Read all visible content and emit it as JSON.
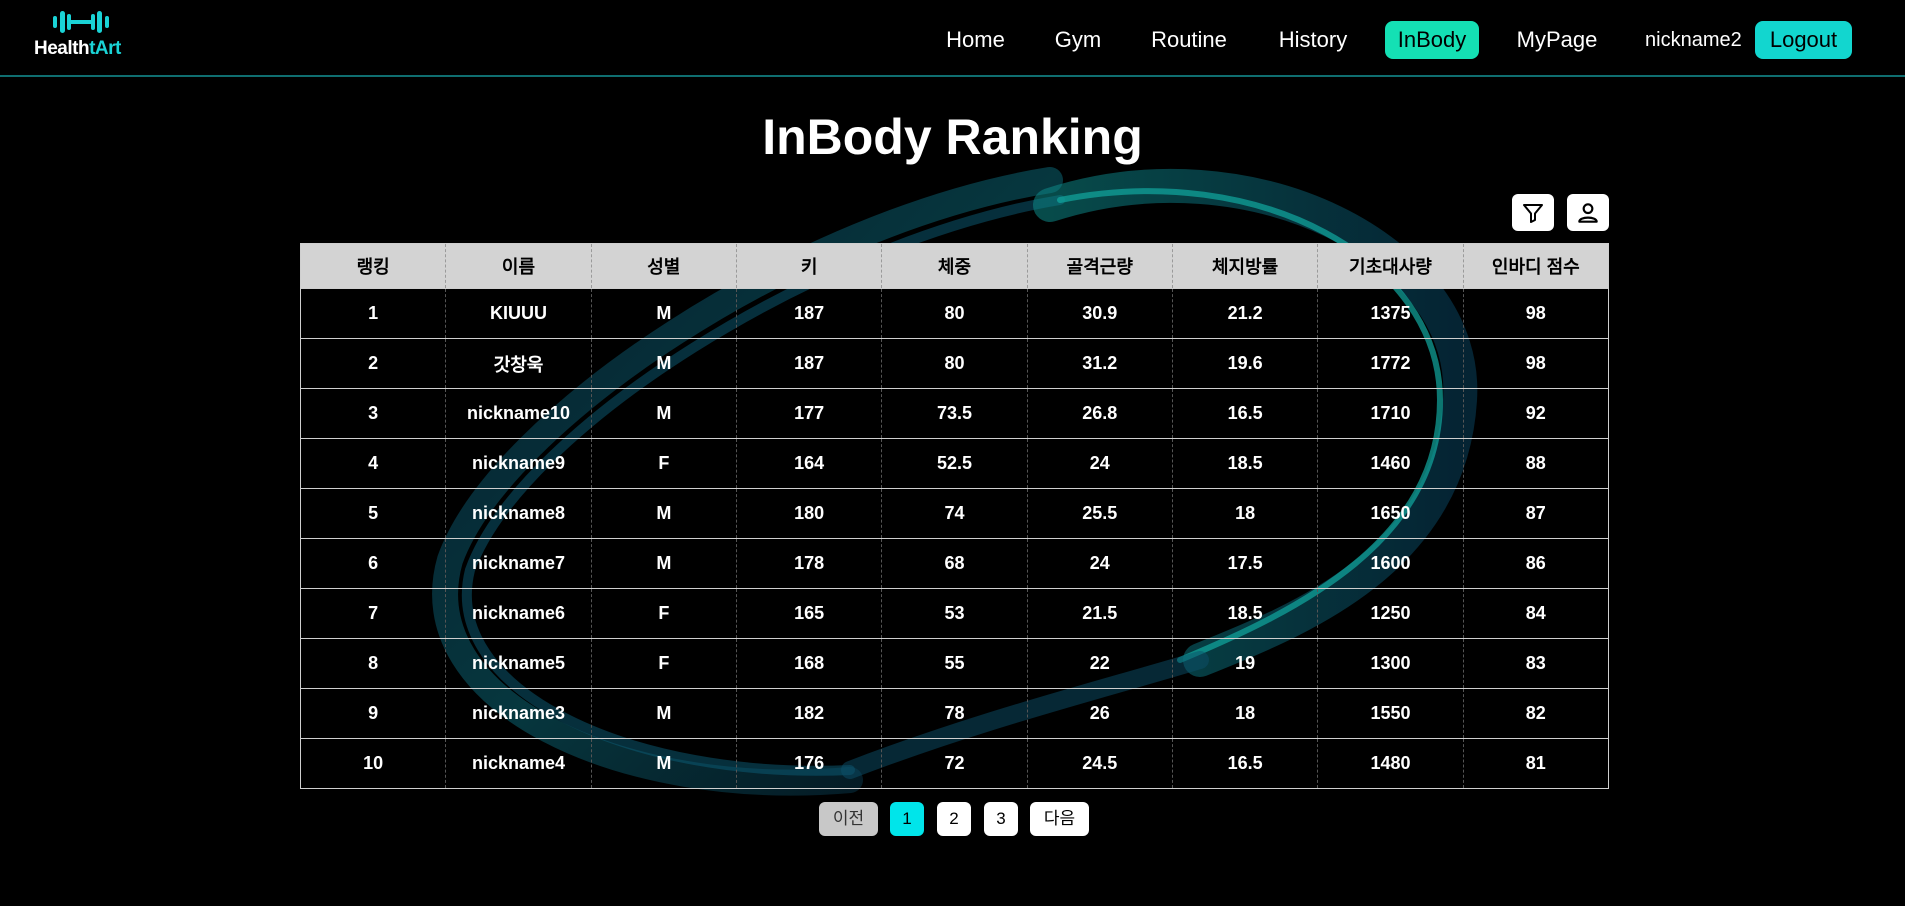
{
  "app": {
    "logo_text_white": "Health",
    "logo_text_cyan": "tArt"
  },
  "nav": {
    "items": [
      {
        "label": "Home"
      },
      {
        "label": "Gym"
      },
      {
        "label": "Routine"
      },
      {
        "label": "History"
      },
      {
        "label": "InBody",
        "active": true
      },
      {
        "label": "MyPage"
      }
    ],
    "username": "nickname2",
    "logout_label": "Logout"
  },
  "page": {
    "title": "InBody Ranking"
  },
  "tools": {
    "filter_icon": "filter-icon",
    "profile_icon": "user-icon"
  },
  "table": {
    "headers": [
      "랭킹",
      "이름",
      "성별",
      "키",
      "체중",
      "골격근량",
      "체지방률",
      "기초대사량",
      "인바디 점수"
    ],
    "rows": [
      [
        "1",
        "KIUUU",
        "M",
        "187",
        "80",
        "30.9",
        "21.2",
        "1375",
        "98"
      ],
      [
        "2",
        "갓창욱",
        "M",
        "187",
        "80",
        "31.2",
        "19.6",
        "1772",
        "98"
      ],
      [
        "3",
        "nickname10",
        "M",
        "177",
        "73.5",
        "26.8",
        "16.5",
        "1710",
        "92"
      ],
      [
        "4",
        "nickname9",
        "F",
        "164",
        "52.5",
        "24",
        "18.5",
        "1460",
        "88"
      ],
      [
        "5",
        "nickname8",
        "M",
        "180",
        "74",
        "25.5",
        "18",
        "1650",
        "87"
      ],
      [
        "6",
        "nickname7",
        "M",
        "178",
        "68",
        "24",
        "17.5",
        "1600",
        "86"
      ],
      [
        "7",
        "nickname6",
        "F",
        "165",
        "53",
        "21.5",
        "18.5",
        "1250",
        "84"
      ],
      [
        "8",
        "nickname5",
        "F",
        "168",
        "55",
        "22",
        "19",
        "1300",
        "83"
      ],
      [
        "9",
        "nickname3",
        "M",
        "182",
        "78",
        "26",
        "18",
        "1550",
        "82"
      ],
      [
        "10",
        "nickname4",
        "M",
        "176",
        "72",
        "24.5",
        "16.5",
        "1480",
        "81"
      ]
    ]
  },
  "pagination": {
    "prev_label": "이전",
    "pages": [
      "1",
      "2",
      "3"
    ],
    "current": "1",
    "next_label": "다음"
  },
  "colors": {
    "accent_cyan": "#00e5ea",
    "active_nav": "#14e0b4",
    "logout": "#12d6cf",
    "header_line": "#0f6e70"
  }
}
